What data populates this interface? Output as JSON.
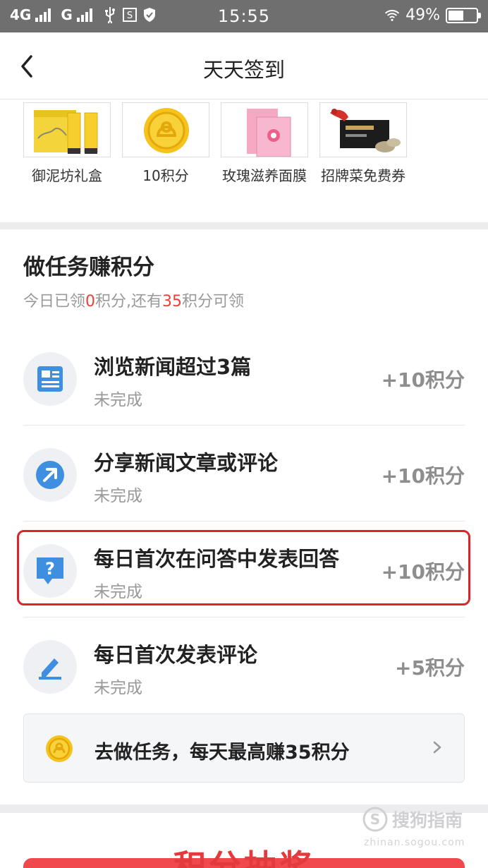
{
  "status_bar": {
    "network1": "4G",
    "network2": "G",
    "time": "15:55",
    "battery": "49%"
  },
  "header": {
    "title": "天天签到"
  },
  "rewards": [
    {
      "name": "御泥坊礼盒"
    },
    {
      "name": "10积分"
    },
    {
      "name": "玫瑰滋养面膜"
    },
    {
      "name": "招牌菜免费券"
    }
  ],
  "tasks_section": {
    "title": "做任务赚积分",
    "subtitle_part1": "今日已领",
    "subtitle_claimed": "0",
    "subtitle_part2": "积分,还有",
    "subtitle_remaining": "35",
    "subtitle_part3": "积分可领"
  },
  "tasks": [
    {
      "name": "浏览新闻超过3篇",
      "status": "未完成",
      "points": "+10积分",
      "icon": "news-icon"
    },
    {
      "name": "分享新闻文章或评论",
      "status": "未完成",
      "points": "+10积分",
      "icon": "share-icon"
    },
    {
      "name": "每日首次在问答中发表回答",
      "status": "未完成",
      "points": "+10积分",
      "icon": "question-icon"
    },
    {
      "name": "每日首次发表评论",
      "status": "未完成",
      "points": "+5积分",
      "icon": "pen-icon"
    }
  ],
  "go_tasks": {
    "label": "去做任务，每天最高赚35积分"
  },
  "lottery": {
    "title": "积分抽奖"
  },
  "watermark": {
    "brand": "搜狗指南",
    "url": "zhinan.sogou.com"
  },
  "colors": {
    "accent_red": "#e8413a",
    "icon_blue": "#3f8fe0",
    "coin_yellow": "#f6c21c"
  }
}
